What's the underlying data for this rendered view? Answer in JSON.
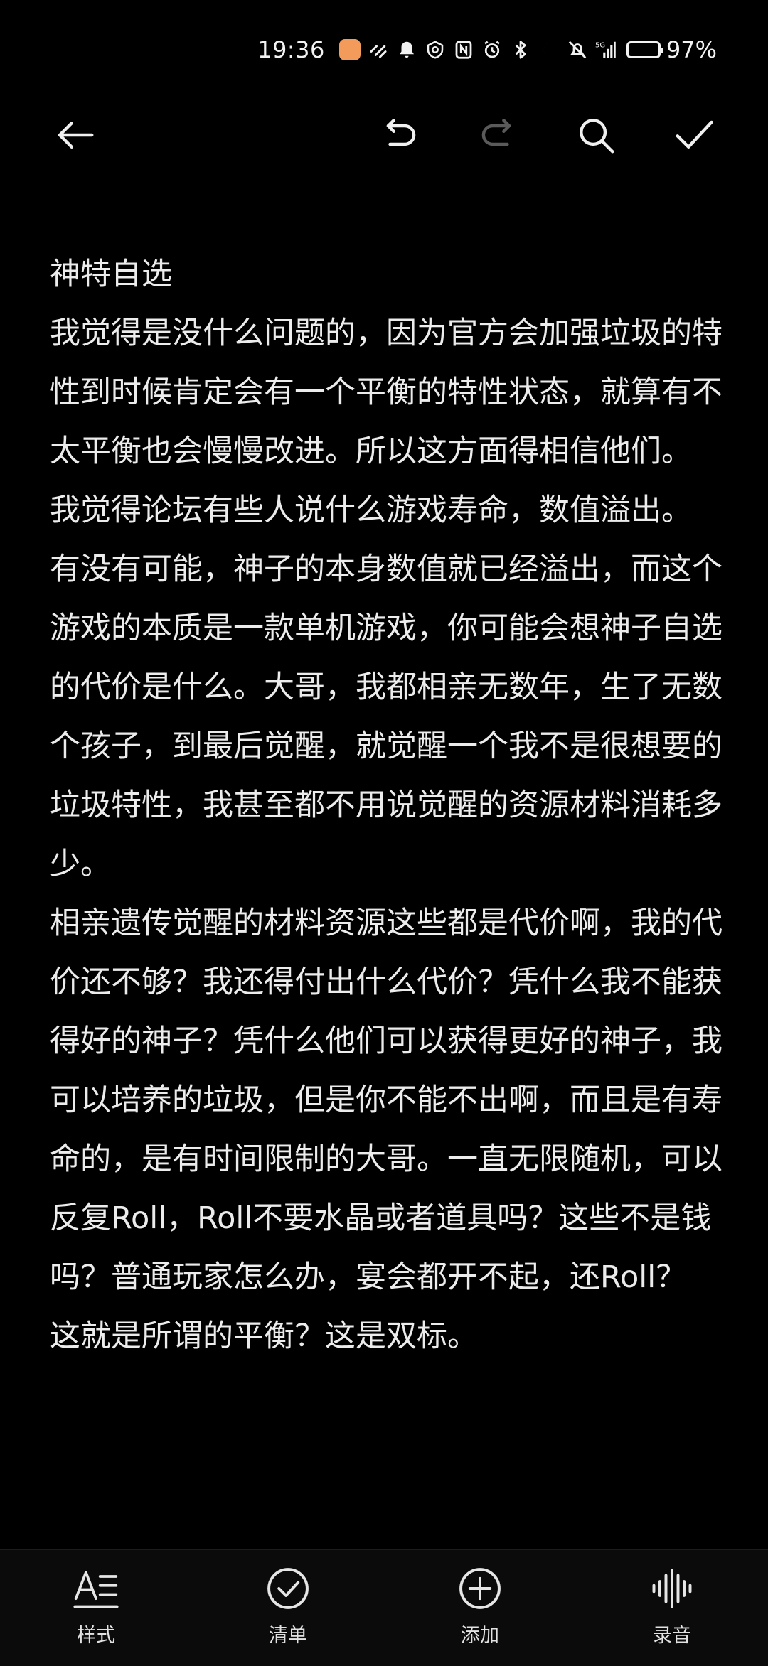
{
  "status_bar": {
    "time": "19:36",
    "battery_percent_label": "97%",
    "battery_level": 0.97,
    "icons": [
      "app-badge-icon",
      "link-icon",
      "notification-bell-icon",
      "shield-icon",
      "nfc-icon",
      "alarm-icon",
      "bluetooth-icon",
      "moon-icon",
      "mute-icon",
      "signal-5g-icon",
      "battery-icon"
    ]
  },
  "toolbar": {
    "back_icon": "arrow-left-icon",
    "undo_icon": "undo-icon",
    "redo_icon": "redo-icon",
    "search_icon": "search-icon",
    "confirm_icon": "check-icon"
  },
  "note": {
    "paragraphs": [
      "神特自选",
      "我觉得是没什么问题的，因为官方会加强垃圾的特性到时候肯定会有一个平衡的特性状态，就算有不太平衡也会慢慢改进。所以这方面得相信他们。",
      "我觉得论坛有些人说什么游戏寿命，数值溢出。",
      "有没有可能，神子的本身数值就已经溢出，而这个游戏的本质是一款单机游戏，你可能会想神子自选的代价是什么。大哥，我都相亲无数年，生了无数个孩子，到最后觉醒，就觉醒一个我不是很想要的垃圾特性，我甚至都不用说觉醒的资源材料消耗多少。",
      "相亲遗传觉醒的材料资源这些都是代价啊，我的代价还不够？我还得付出什么代价？凭什么我不能获得好的神子？凭什么他们可以获得更好的神子，我可以培养的垃圾，但是你不能不出啊，而且是有寿命的，是有时间限制的大哥。一直无限随机，可以反复Roll，Roll不要水晶或者道具吗？这些不是钱吗？普通玩家怎么办，宴会都开不起，还Roll？",
      "这就是所谓的平衡？这是双标。"
    ]
  },
  "bottom_bar": {
    "items": [
      {
        "label": "样式",
        "icon": "text-style-icon"
      },
      {
        "label": "清单",
        "icon": "checklist-icon"
      },
      {
        "label": "添加",
        "icon": "add-icon"
      },
      {
        "label": "录音",
        "icon": "voice-record-icon"
      }
    ]
  },
  "colors": {
    "background": "#000000",
    "text": "#ececec",
    "icon": "#f0f0f0",
    "icon_disabled": "#5a5a5a",
    "app_badge": "#f39b5a"
  }
}
